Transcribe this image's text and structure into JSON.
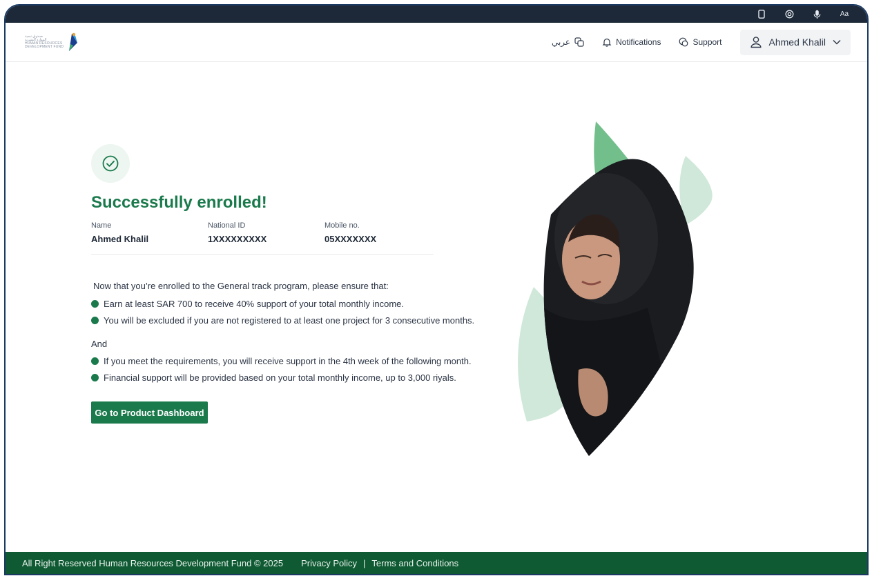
{
  "system_icons": [
    "phone-icon",
    "eye-icon",
    "mic-icon",
    "text-size-icon"
  ],
  "system_text_size_label": "Aa",
  "header": {
    "logo_lines": [
      "صندوق تنمية",
      "الموارد البشرية",
      "HUMAN RESOURCES",
      "DEVELOPMENT FUND"
    ],
    "language_label": "عربي",
    "notifications_label": "Notifications",
    "support_label": "Support",
    "user_name": "Ahmed Khalil"
  },
  "main": {
    "title": "Successfully enrolled!",
    "fields": [
      {
        "label": "Name",
        "value": "Ahmed Khalil"
      },
      {
        "label": "National ID",
        "value": "1XXXXXXXXX"
      },
      {
        "label": "Mobile no.",
        "value": "05XXXXXXX"
      }
    ],
    "intro": "Now that you’re enrolled to the General track program, please ensure that:",
    "requirements": [
      "Earn at least SAR 700 to receive 40% support of your total monthly income.",
      "You will be excluded if you are not registered to at least one project for 3 consecutive months."
    ],
    "and_label": "And",
    "benefits": [
      "If you meet the requirements, you will receive support in the 4th week of the following month.",
      "Financial support will be provided based on your total monthly income, up to 3,000 riyals."
    ],
    "cta_label": "Go to Product Dashboard"
  },
  "footer": {
    "copyright": "All Right Reserved Human Resources Development Fund © 2025",
    "privacy_label": "Privacy Policy",
    "separator": "|",
    "terms_label": "Terms and Conditions"
  },
  "colors": {
    "brand_green": "#1a7a4c",
    "footer_green": "#0f5a33",
    "leaf_green": "#72bf8c",
    "leaf_light": "#cfe8d9",
    "topbar": "#1d2938"
  }
}
